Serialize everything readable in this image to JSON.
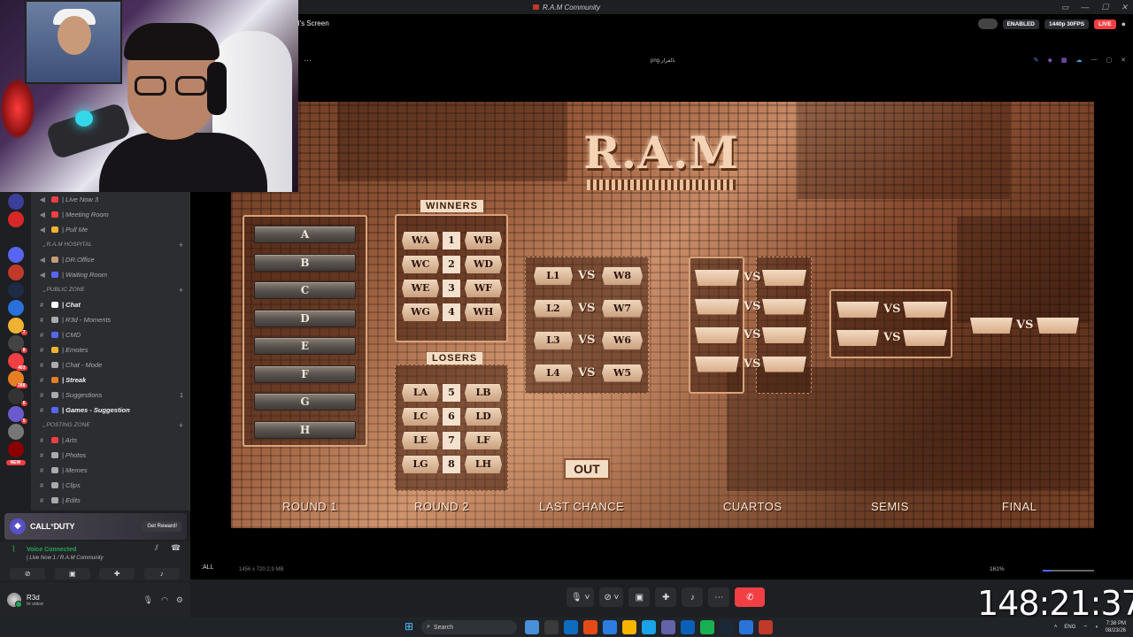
{
  "window": {
    "title": "R.A.M Community",
    "controls": [
      "▭",
      "—",
      "☐",
      "✕"
    ]
  },
  "servers": [
    {
      "color": "#3b3f9a",
      "badge": ""
    },
    {
      "color": "#d62828",
      "badge": ""
    },
    {
      "color": "#1e1f22",
      "badge": ""
    },
    {
      "color": "#5865f2",
      "badge": ""
    },
    {
      "color": "#c0392b",
      "badge": ""
    },
    {
      "color": "#1f2a44",
      "badge": ""
    },
    {
      "color": "#2a6fdb",
      "badge": ""
    },
    {
      "color": "#f0b232",
      "badge": "7"
    },
    {
      "color": "#444",
      "badge": "8"
    },
    {
      "color": "#f23f43",
      "badge": "403"
    },
    {
      "color": "#e67e22",
      "badge": "288"
    },
    {
      "color": "#333",
      "badge": "6"
    },
    {
      "color": "#6a5acd",
      "badge": "5"
    },
    {
      "color": "#777",
      "badge": ""
    },
    {
      "color": "#8b0000",
      "badge": ""
    }
  ],
  "new_label": "NEW",
  "channels": [
    {
      "kind": "voice",
      "label": "| Live Now 3",
      "color": "#f23f43",
      "bold": false,
      "count": ""
    },
    {
      "kind": "voice",
      "label": "| Meeting Room",
      "color": "#f23f43",
      "bold": false,
      "count": ""
    },
    {
      "kind": "voice",
      "label": "| Pull Me",
      "color": "#f0b232",
      "bold": false,
      "count": ""
    },
    {
      "kind": "category",
      "label": "R.A.M HOSPITAL",
      "count": ""
    },
    {
      "kind": "voice",
      "label": "| DR.Office",
      "color": "#c89a7a",
      "bold": false,
      "count": ""
    },
    {
      "kind": "voice",
      "label": "| Waiting Room",
      "color": "#5865f2",
      "bold": false,
      "count": ""
    },
    {
      "kind": "category",
      "label": "PUBLIC ZONE",
      "count": ""
    },
    {
      "kind": "text",
      "label": "| Chat",
      "color": "#fff",
      "bold": true,
      "count": ""
    },
    {
      "kind": "text",
      "label": "| R3d - Moments",
      "color": "#aaa",
      "bold": false,
      "count": ""
    },
    {
      "kind": "text",
      "label": "| CMD",
      "color": "#5865f2",
      "bold": false,
      "count": ""
    },
    {
      "kind": "text",
      "label": "| Emotes",
      "color": "#f0b232",
      "bold": false,
      "count": ""
    },
    {
      "kind": "text",
      "label": "| Chat - Mode",
      "color": "#aaa",
      "bold": false,
      "count": ""
    },
    {
      "kind": "text",
      "label": "| Streak",
      "color": "#e67e22",
      "bold": true,
      "count": ""
    },
    {
      "kind": "text",
      "label": "| Suggestions",
      "color": "#aaa",
      "bold": false,
      "count": "1"
    },
    {
      "kind": "text",
      "label": "| Games - Suggestion",
      "color": "#5865f2",
      "bold": true,
      "count": ""
    },
    {
      "kind": "category",
      "label": "POSTING ZONE",
      "count": ""
    },
    {
      "kind": "text",
      "label": "| Arts",
      "color": "#f23f43",
      "bold": false,
      "count": ""
    },
    {
      "kind": "text",
      "label": "| Photos",
      "color": "#aaa",
      "bold": false,
      "count": ""
    },
    {
      "kind": "text",
      "label": "| Memes",
      "color": "#aaa",
      "bold": false,
      "count": ""
    },
    {
      "kind": "text",
      "label": "| Clips",
      "color": "#aaa",
      "bold": false,
      "count": ""
    },
    {
      "kind": "text",
      "label": "| Edits",
      "color": "#aaa",
      "bold": false,
      "count": ""
    }
  ],
  "promo": {
    "title": "CALL°DUTY",
    "button": "Get Reward!"
  },
  "voice": {
    "status": "Voice Connected",
    "channel": "| Live Now 1 / R.A.M Community"
  },
  "user": {
    "name": "R3d",
    "status": "In voice"
  },
  "stream": {
    "name": "ll's Screen",
    "enabled_label": "ENABLED",
    "quality_label": "1440p 30FPS",
    "live_label": "LIVE",
    "inner_title": "png.بالقرار",
    "footer_label": ":ALL",
    "footer_meta": "1456 x 720    2.9 MB",
    "zoom": "161%"
  },
  "bracket": {
    "logo": "R.A.M",
    "winners_label": "WINNERS",
    "losers_label": "LOSERS",
    "out_label": "OUT",
    "vs_label": "VS",
    "groups": [
      "A",
      "B",
      "C",
      "D",
      "E",
      "F",
      "G",
      "H"
    ],
    "winners": [
      [
        "WA",
        "1",
        "WB"
      ],
      [
        "WC",
        "2",
        "WD"
      ],
      [
        "WE",
        "3",
        "WF"
      ],
      [
        "WG",
        "4",
        "WH"
      ]
    ],
    "losers": [
      [
        "LA",
        "5",
        "LB"
      ],
      [
        "LC",
        "6",
        "LD"
      ],
      [
        "LE",
        "7",
        "LF"
      ],
      [
        "LG",
        "8",
        "LH"
      ]
    ],
    "last_chance": [
      [
        "L1",
        "W8"
      ],
      [
        "L2",
        "W7"
      ],
      [
        "L3",
        "W6"
      ],
      [
        "L4",
        "W5"
      ]
    ],
    "rounds": [
      "ROUND 1",
      "ROUND 2",
      "LAST CHANCE",
      "CUARTOS",
      "SEMIS",
      "FINAL"
    ]
  },
  "timer": "148:21:37",
  "taskbar": {
    "search": "Search",
    "lang": "ENG",
    "time": "7:38 PM",
    "date": "08/23/26"
  }
}
